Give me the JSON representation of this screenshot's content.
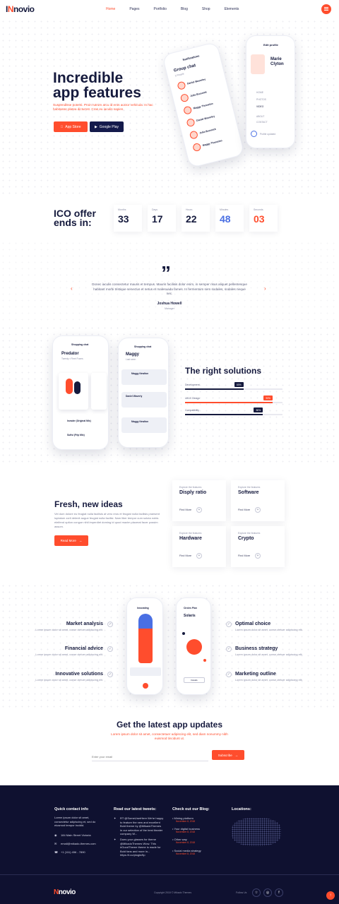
{
  "header": {
    "logo_prefix": "I",
    "logo_mark": "N",
    "logo_text": "novio",
    "nav": [
      "Home",
      "Pages",
      "Portfolio",
      "Blog",
      "Shop",
      "Elements"
    ],
    "active_nav": "Home"
  },
  "hero": {
    "title_line1": "Incredible",
    "title_line2": "app features",
    "description": "Suspendisse potenti. Proin rutrum arcu id eros auctor vehicula. In hac habitasse platea dictumst. Cras eu iaculis sapien.",
    "app_store_small": "Download on the",
    "app_store": "App Store",
    "google_play_small": "Download on",
    "google_play": "Google Play",
    "phone1": {
      "header": "Notifications",
      "title": "Group chat",
      "subtitle": "5 People",
      "people": [
        "Daniel Waverley",
        "Julia Brusnick",
        "Maggy Thomelso",
        "Daniel Waverley",
        "Julia Brusnick",
        "Maggy Thomelso"
      ]
    },
    "phone2": {
      "header": "Edit profile",
      "name_first": "Marie",
      "name_last": "Clyton",
      "menu": [
        "HOME",
        "PHOTOS",
        "VIDEO",
        "ABOUT",
        "CONTACT"
      ],
      "footer": "Profile updated"
    }
  },
  "countdown": {
    "title_line1": "ICO offer",
    "title_line2": "ends in:",
    "items": [
      {
        "label": "Months",
        "value": "33",
        "color": "#151a3d"
      },
      {
        "label": "Days",
        "value": "17",
        "color": "#151a3d"
      },
      {
        "label": "Hours",
        "value": "22",
        "color": "#151a3d"
      },
      {
        "label": "Minutes",
        "value": "48",
        "color": "#4a6fe3"
      },
      {
        "label": "Seconds",
        "value": "03",
        "color": "#ff4d2d"
      }
    ]
  },
  "testimonial": {
    "quote_mark": "”",
    "text": "Donec iaculis consectetur mauris et tempus. Mauris facilisis dolor enim, in semper risus aliquet pellentesque habitant morbi tristique senectus et netus et malesuada fames. In fermentum sem sodales, sodales neque nec.",
    "name": "Joshua Howell",
    "role": "Manager",
    "prev": "‹",
    "next": "›"
  },
  "solutions": {
    "phone1": {
      "header": "Shopping chat",
      "title": "Predator",
      "subtitle": "Twenty • Fleet Foxes",
      "tracks": [
        "Invader (Original Mix)",
        "Sufisi (Frip Mix)"
      ]
    },
    "phone2": {
      "header": "Shopping chat",
      "title": "Maggy",
      "subtitle": "Last seen",
      "messages": [
        "Maggy Newlton",
        "Daniel Waverly",
        "Maggy Newlton"
      ]
    },
    "title": "The right solutions",
    "bars": [
      {
        "label": "Development",
        "percent": 60,
        "badge": "60%",
        "color": "#151a3d"
      },
      {
        "label": "Ul/UX Design",
        "percent": 90,
        "badge": "90%",
        "color": "#ff4d2d"
      },
      {
        "label": "Compatibility",
        "percent": 80,
        "badge": "80%",
        "color": "#151a3d"
      }
    ]
  },
  "fresh": {
    "title": "Fresh, new ideas",
    "description": "Vel dum dolore eu feugiat nulla facilisis at vero eros et feugiat nulla facilisis praesent luptatum zzril delenit augue feugiat nulla facilisi. Nam liber tempor cum soluta nobis eleifend option congue nihil imperdiet doming id quod mazim placerat facer possim assum.",
    "button": "Read More",
    "cards": [
      {
        "kicker": "Explore the features",
        "title": "Disply ratio",
        "link": "Find More"
      },
      {
        "kicker": "Explore the features",
        "title": "Software",
        "link": "Find More"
      },
      {
        "kicker": "Explore the features",
        "title": "Hardware",
        "link": "Find More"
      },
      {
        "kicker": "Explore the features",
        "title": "Crypto",
        "link": "Find More"
      }
    ]
  },
  "features": {
    "left": [
      {
        "title": "Market analysis",
        "desc": "Lorem ipsum dolor sit amet, conse ctetuer adipiscing elit."
      },
      {
        "title": "Financial advice",
        "desc": "Lorem ipsum dolor sit amet, conse ctetuer adipiscing elit."
      },
      {
        "title": "Innovative solutions",
        "desc": "Lorem ipsum dolor sit amet, conse ctetuer adipiscing elit."
      }
    ],
    "right": [
      {
        "title": "Optimal choice",
        "desc": "Lorem ipsum dolor sit amet, conse ctetuer adipiscing elit."
      },
      {
        "title": "Business strategy",
        "desc": "Lorem ipsum dolor sit amet, conse ctetuer adipiscing elit."
      },
      {
        "title": "Marketing outline",
        "desc": "Lorem ipsum dolor sit amet, conse ctetuer adipiscing elit."
      }
    ],
    "phone1_header": "Innovating",
    "phone2_header": "Circles Plan",
    "phone2_title": "Solaris",
    "phone2_button": "Details"
  },
  "subscribe": {
    "title": "Get the latest app updates",
    "description": "Lorem ipsum dolor sit amet, consectetuer adipiscing elit, sed diam nonummy nibh euismod tincidunt ut.",
    "placeholder": "Enter your email",
    "button": "Subscribe"
  },
  "footer": {
    "contact": {
      "heading": "Quick contact info",
      "text": "Lorem ipsum dolor sit amet, consectetur adipiscing et, sed do eiusmod tempor incidid.",
      "address": "184 Main Street Victoria",
      "email": "email@mikado-themes.com",
      "phone": "+1 (111) 456 - 7890"
    },
    "tweets": {
      "heading": "Read our latest tweets:",
      "items": [
        "RT @SomeUserHere We're happy to feature the new and excellent Bold theme by @MikadoThemes in our selection of the best theater company W...",
        "Does your glasses for theme @MikadoThemes Wow. This #GoodTheme theme is made for Bold fans and more in... https://t.co/plugin/ltp"
      ]
    },
    "blog": {
      "heading": "Check out our Blog:",
      "items": [
        {
          "title": "Mining platform",
          "date": "November 8, 2018"
        },
        {
          "title": "Your digital business",
          "date": "November 8, 2018"
        },
        {
          "title": "Other way",
          "date": "November 8, 2018"
        },
        {
          "title": "Social media strategy",
          "date": "November 8, 2018"
        }
      ]
    },
    "locations": {
      "heading": "Locations:"
    },
    "logo": "novio",
    "copyright": "Copyright 2018 © Mikado Themes",
    "follow": "Follow Us",
    "socials": [
      "☆",
      "◎",
      "f"
    ]
  }
}
